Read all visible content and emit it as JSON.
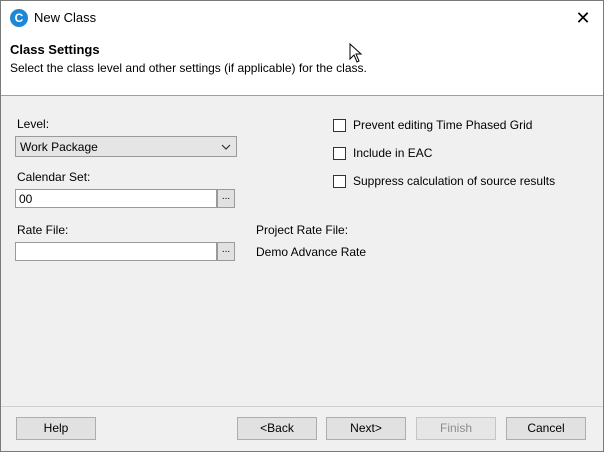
{
  "window": {
    "title": "New Class"
  },
  "header": {
    "title": "Class Settings",
    "subtitle": "Select the class level and other settings (if applicable) for the class."
  },
  "form": {
    "level_label": "Level:",
    "level_value": "Work Package",
    "calendar_label": "Calendar Set:",
    "calendar_value": "00",
    "rate_file_label": "Rate File:",
    "rate_file_value": "",
    "browse_label": "...",
    "project_rate_label": "Project Rate File:",
    "project_rate_value": "Demo Advance Rate"
  },
  "options": [
    {
      "label": "Prevent editing Time Phased Grid",
      "checked": false
    },
    {
      "label": "Include in EAC",
      "checked": false
    },
    {
      "label": "Suppress calculation of source results",
      "checked": false
    }
  ],
  "buttons": {
    "help": "Help",
    "back": "<Back",
    "next": "Next>",
    "finish": "Finish",
    "cancel": "Cancel"
  },
  "icons": {
    "app": "app-logo-icon",
    "close": "close-icon",
    "dropdown": "chevron-down-icon",
    "cursor": "mouse-pointer-icon"
  }
}
